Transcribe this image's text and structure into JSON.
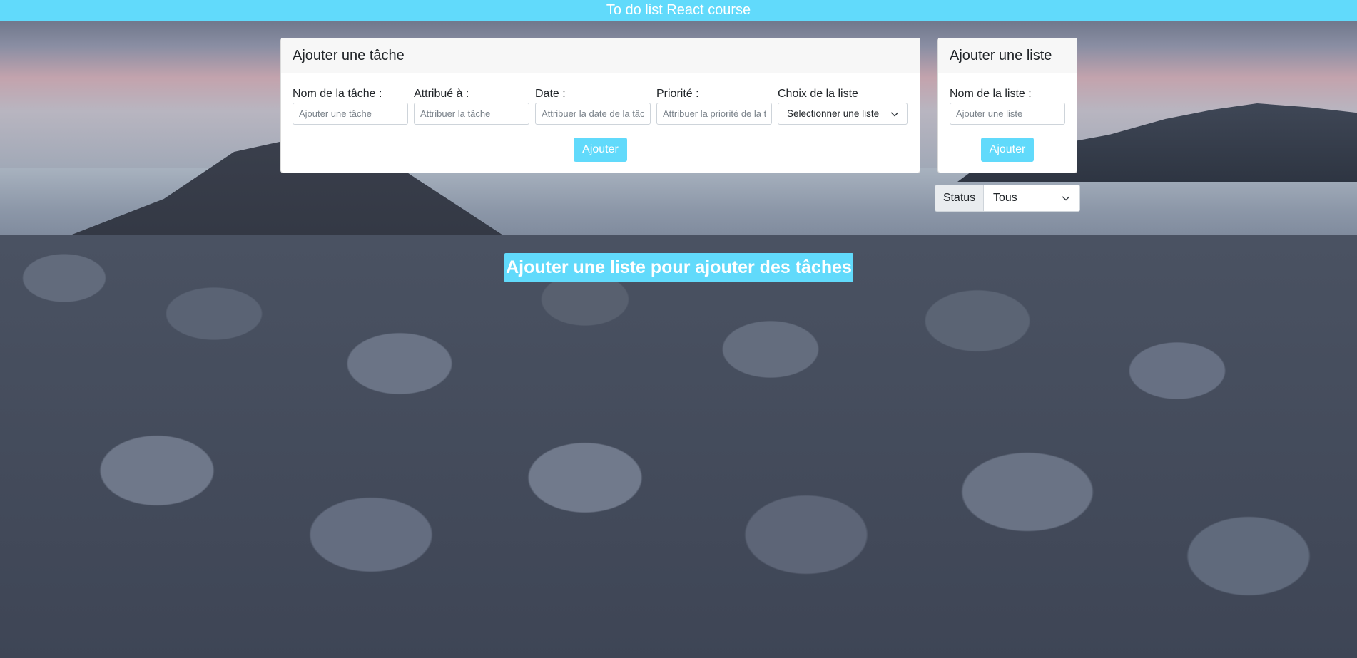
{
  "header": {
    "title": "To do list React course"
  },
  "task_form": {
    "title": "Ajouter une tâche",
    "fields": [
      {
        "label": "Nom de la tâche :",
        "placeholder": "Ajouter une tâche"
      },
      {
        "label": "Attribué à :",
        "placeholder": "Attribuer la tâche"
      },
      {
        "label": "Date :",
        "placeholder": "Attribuer la date de la tâche"
      },
      {
        "label": "Priorité :",
        "placeholder": "Attribuer la priorité de la tâche"
      }
    ],
    "list_choice": {
      "label": "Choix de la liste",
      "selected": "Selectionner une liste"
    },
    "submit_label": "Ajouter"
  },
  "list_form": {
    "title": "Ajouter une liste",
    "field": {
      "label": "Nom de la liste :",
      "placeholder": "Ajouter une liste"
    },
    "submit_label": "Ajouter"
  },
  "status_filter": {
    "label": "Status",
    "selected": "Tous"
  },
  "banner": {
    "text": "Ajouter une liste pour ajouter des tâches"
  },
  "colors": {
    "accent": "#61dafb",
    "card_header": "#f7f7f7"
  },
  "icons": {
    "select_arrow": "chevron-down-icon"
  }
}
